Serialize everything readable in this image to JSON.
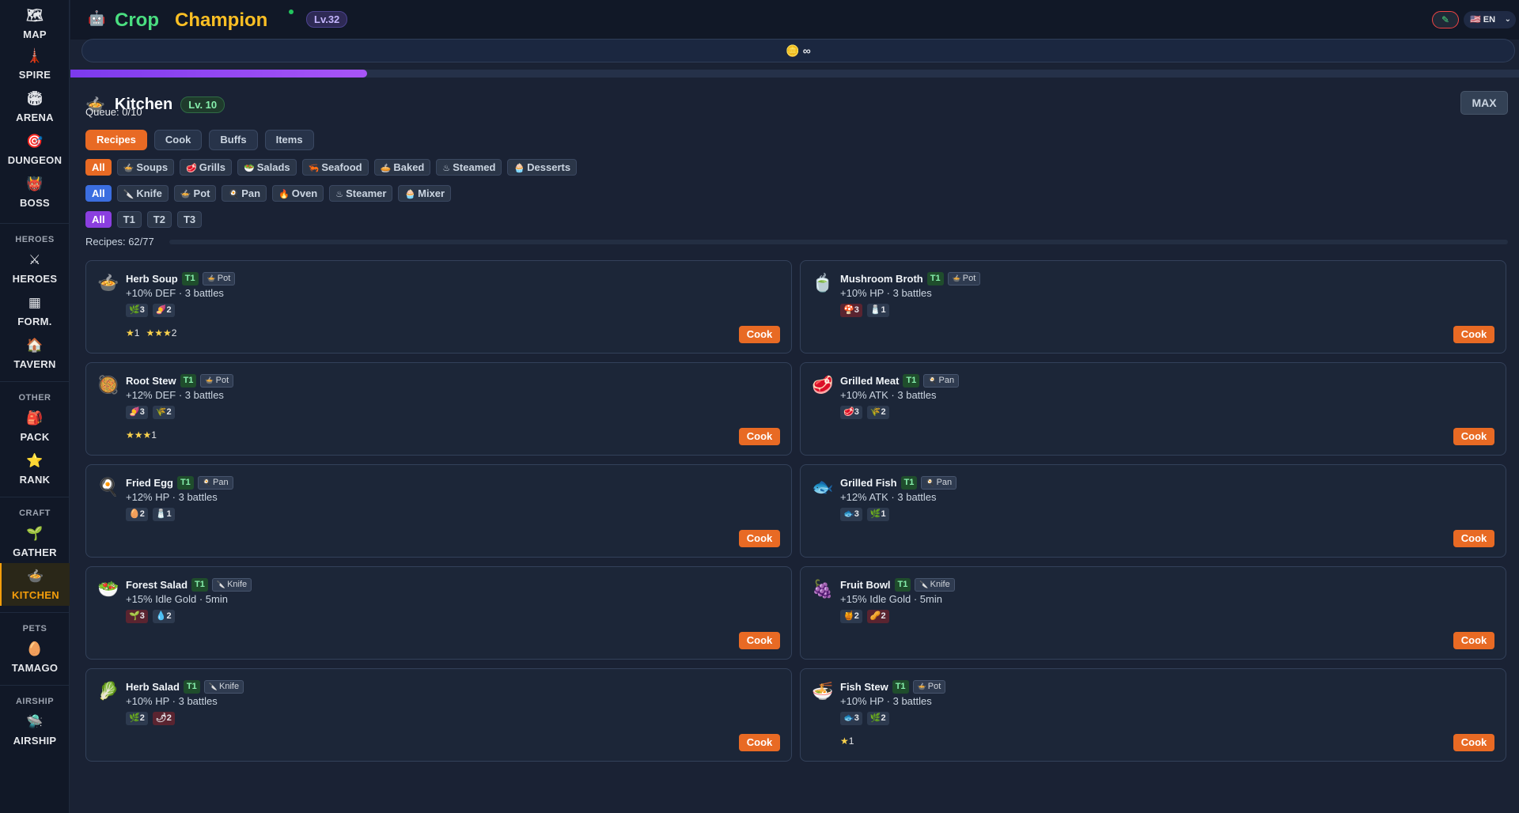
{
  "header": {
    "title_part1": "Crop",
    "title_part2": "Champion",
    "level": "Lv.32",
    "edit_icon": "✎",
    "lang": "🇺🇸 EN",
    "currency_icon": "coin-icon",
    "currency_value": "∞",
    "xp_progress": 0.205
  },
  "sidebar": {
    "items": [
      {
        "icon": "🗺",
        "label": "MAP"
      },
      {
        "icon": "🗼",
        "label": "SPIRE"
      },
      {
        "icon": "🏟",
        "label": "ARENA"
      },
      {
        "icon": "🎯",
        "label": "DUNGEON"
      },
      {
        "icon": "👹",
        "label": "BOSS"
      }
    ],
    "sections": [
      {
        "title": "HEROES",
        "items": [
          {
            "icon": "⚔",
            "label": "HEROES"
          },
          {
            "icon": "▦",
            "label": "FORM."
          },
          {
            "icon": "🏠",
            "label": "TAVERN"
          }
        ]
      },
      {
        "title": "OTHER",
        "items": [
          {
            "icon": "🎒",
            "label": "PACK"
          },
          {
            "icon": "⭐",
            "label": "RANK"
          }
        ]
      },
      {
        "title": "CRAFT",
        "items": [
          {
            "icon": "🌱",
            "label": "GATHER"
          },
          {
            "icon": "🍲",
            "label": "KITCHEN"
          }
        ]
      },
      {
        "title": "PETS",
        "items": [
          {
            "icon": "🥚",
            "label": "TAMAGO"
          }
        ]
      },
      {
        "title": "AIRSHIP",
        "items": [
          {
            "icon": "🛸",
            "label": "AIRSHIP"
          }
        ]
      }
    ]
  },
  "kitchen": {
    "icon": "🍲",
    "title": "Kitchen",
    "level": "Lv. 10",
    "max_label": "MAX",
    "queue": "Queue: 0/10",
    "tabs": [
      "Recipes",
      "Cook",
      "Buffs",
      "Items"
    ],
    "categories": [
      "All",
      "Soups",
      "Grills",
      "Salads",
      "Seafood",
      "Baked",
      "Steamed",
      "Desserts"
    ],
    "category_icons": [
      "",
      "🍲",
      "🥩",
      "🥗",
      "🦐",
      "🥧",
      "♨",
      "🧁"
    ],
    "tools": [
      "All",
      "Knife",
      "Pot",
      "Pan",
      "Oven",
      "Steamer",
      "Mixer"
    ],
    "tool_icons": [
      "",
      "🔪",
      "🍲",
      "🍳",
      "🔥",
      "♨",
      "🧁"
    ],
    "tiers": [
      "All",
      "T1",
      "T2",
      "T3"
    ],
    "recipes_count": "Recipes: 62/77",
    "cook_label": "Cook"
  },
  "recipes": [
    {
      "icon": "🍲",
      "name": "Herb Soup",
      "tier": "T1",
      "tool_icon": "🍲",
      "tool": "Pot",
      "effect": "+10% DEF · 3 battles",
      "ingredients": [
        {
          "icon": "🌿",
          "qty": "3",
          "red": false
        },
        {
          "icon": "🍠",
          "qty": "2",
          "red": false
        }
      ],
      "stars": [
        {
          "s": "★",
          "n": "1"
        },
        {
          "s": "★★★",
          "n": "2"
        }
      ]
    },
    {
      "icon": "🍵",
      "name": "Mushroom Broth",
      "tier": "T1",
      "tool_icon": "🍲",
      "tool": "Pot",
      "effect": "+10% HP · 3 battles",
      "ingredients": [
        {
          "icon": "🍄",
          "qty": "3",
          "red": true
        },
        {
          "icon": "🧂",
          "qty": "1",
          "red": false
        }
      ],
      "stars": []
    },
    {
      "icon": "🥘",
      "name": "Root Stew",
      "tier": "T1",
      "tool_icon": "🍲",
      "tool": "Pot",
      "effect": "+12% DEF · 3 battles",
      "ingredients": [
        {
          "icon": "🍠",
          "qty": "3",
          "red": false
        },
        {
          "icon": "🌾",
          "qty": "2",
          "red": false
        }
      ],
      "stars": [
        {
          "s": "★★★",
          "n": "1"
        }
      ]
    },
    {
      "icon": "🥩",
      "name": "Grilled Meat",
      "tier": "T1",
      "tool_icon": "🍳",
      "tool": "Pan",
      "effect": "+10% ATK · 3 battles",
      "ingredients": [
        {
          "icon": "🥩",
          "qty": "3",
          "red": false
        },
        {
          "icon": "🌾",
          "qty": "2",
          "red": false
        }
      ],
      "stars": []
    },
    {
      "icon": "🍳",
      "name": "Fried Egg",
      "tier": "T1",
      "tool_icon": "🍳",
      "tool": "Pan",
      "effect": "+12% HP · 3 battles",
      "ingredients": [
        {
          "icon": "🥚",
          "qty": "2",
          "red": false
        },
        {
          "icon": "🧂",
          "qty": "1",
          "red": false
        }
      ],
      "stars": []
    },
    {
      "icon": "🐟",
      "name": "Grilled Fish",
      "tier": "T1",
      "tool_icon": "🍳",
      "tool": "Pan",
      "effect": "+12% ATK · 3 battles",
      "ingredients": [
        {
          "icon": "🐟",
          "qty": "3",
          "red": false
        },
        {
          "icon": "🌿",
          "qty": "1",
          "red": false
        }
      ],
      "stars": []
    },
    {
      "icon": "🥗",
      "name": "Forest Salad",
      "tier": "T1",
      "tool_icon": "🔪",
      "tool": "Knife",
      "effect": "+15% Idle Gold · 5min",
      "ingredients": [
        {
          "icon": "🌱",
          "qty": "3",
          "red": true
        },
        {
          "icon": "💧",
          "qty": "2",
          "red": false
        }
      ],
      "stars": []
    },
    {
      "icon": "🍇",
      "name": "Fruit Bowl",
      "tier": "T1",
      "tool_icon": "🔪",
      "tool": "Knife",
      "effect": "+15% Idle Gold · 5min",
      "ingredients": [
        {
          "icon": "🍯",
          "qty": "2",
          "red": false
        },
        {
          "icon": "🥜",
          "qty": "2",
          "red": true
        }
      ],
      "stars": []
    },
    {
      "icon": "🥬",
      "name": "Herb Salad",
      "tier": "T1",
      "tool_icon": "🔪",
      "tool": "Knife",
      "effect": "+10% HP · 3 battles",
      "ingredients": [
        {
          "icon": "🌿",
          "qty": "2",
          "red": false
        },
        {
          "icon": "🌶",
          "qty": "2",
          "red": true
        }
      ],
      "stars": []
    },
    {
      "icon": "🍜",
      "name": "Fish Stew",
      "tier": "T1",
      "tool_icon": "🍲",
      "tool": "Pot",
      "effect": "+10% HP · 3 battles",
      "ingredients": [
        {
          "icon": "🐟",
          "qty": "3",
          "red": false
        },
        {
          "icon": "🌿",
          "qty": "2",
          "red": false
        }
      ],
      "stars": [
        {
          "s": "★",
          "n": "1"
        }
      ]
    }
  ]
}
